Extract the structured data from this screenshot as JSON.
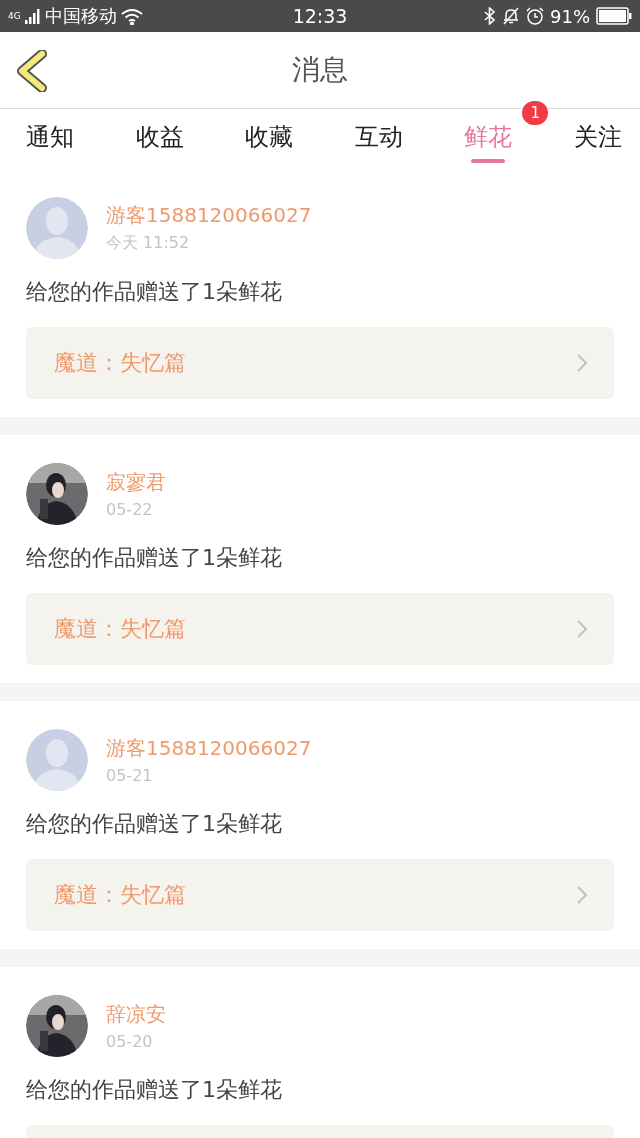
{
  "status_bar": {
    "network": "4G",
    "carrier": "中国移动",
    "time": "12:33",
    "battery": "91%"
  },
  "header": {
    "title": "消息"
  },
  "tabs": [
    {
      "label": "通知",
      "selected": false
    },
    {
      "label": "收益",
      "selected": false
    },
    {
      "label": "收藏",
      "selected": false
    },
    {
      "label": "互动",
      "selected": false
    },
    {
      "label": "鲜花",
      "selected": true,
      "badge": "1"
    },
    {
      "label": "关注",
      "selected": false
    }
  ],
  "messages": [
    {
      "avatar": {
        "kind": "default"
      },
      "name": "游客1588120066027",
      "time": "今天 11:52",
      "text": "给您的作品赠送了1朵鲜花",
      "work": "魔道：失忆篇"
    },
    {
      "name": "寂寥君",
      "time": "05-22",
      "text": "给您的作品赠送了1朵鲜花",
      "work": "魔道：失忆篇"
    },
    {
      "avatar": {
        "kind": "default"
      },
      "name": "游客1588120066027",
      "time": "05-21",
      "text": "给您的作品赠送了1朵鲜花",
      "work": "魔道：失忆篇"
    },
    {
      "name": "辞凉安",
      "time": "05-20",
      "text": "给您的作品赠送了1朵鲜花"
    }
  ]
}
